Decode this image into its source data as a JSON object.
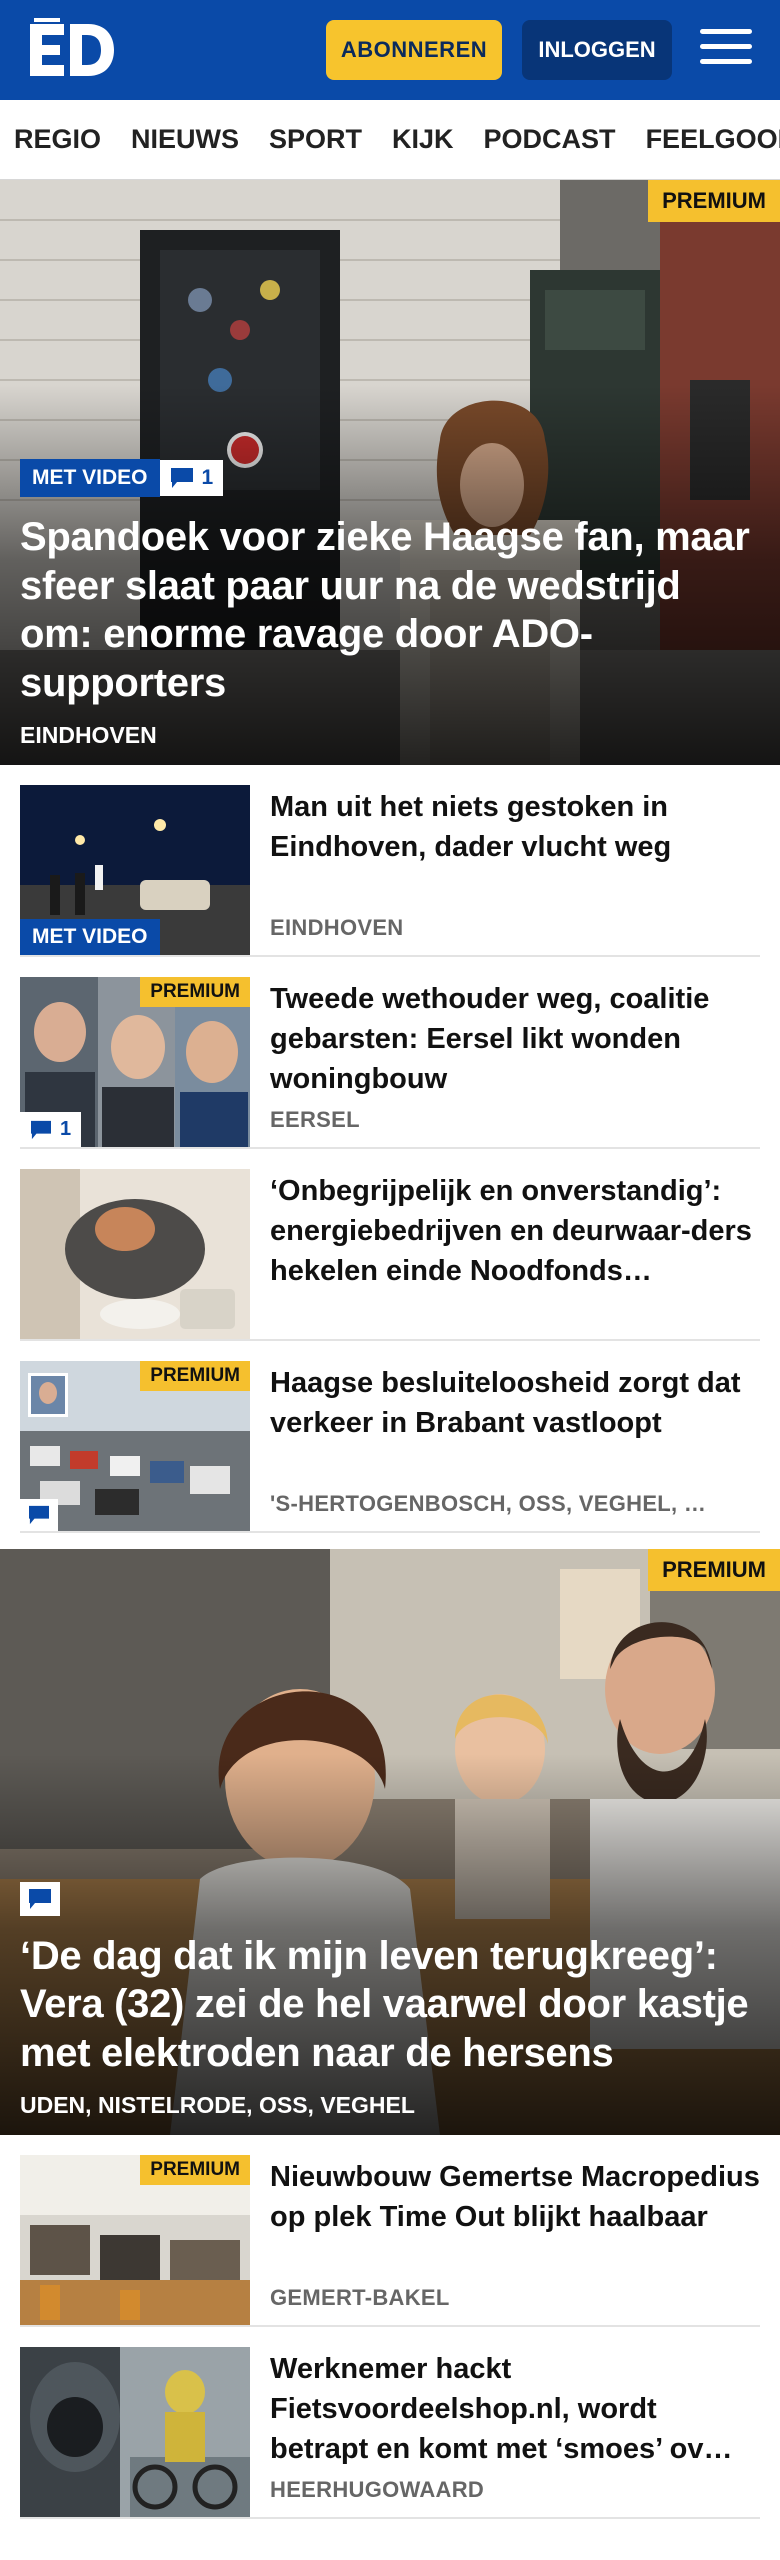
{
  "header": {
    "logo_text": "ED",
    "subscribe_label": "ABONNEREN",
    "login_label": "INLOGGEN",
    "menu_icon": "hamburger-icon"
  },
  "nav": {
    "items": [
      "REGIO",
      "NIEUWS",
      "SPORT",
      "KIJK",
      "PODCAST",
      "FEELGOOD"
    ]
  },
  "hero1": {
    "premium": "PREMIUM",
    "video_label": "MET VIDEO",
    "comment_count": "1",
    "title": "Spandoek voor zieke Haagse fan, maar sfeer slaat paar uur na de wedstrijd om: enorme ravage door ADO-supporters",
    "location": "EINDHOVEN"
  },
  "articles1": [
    {
      "title": "Man uit het niets gestoken in Eindhoven, dader vlucht weg",
      "location": "EINDHOVEN",
      "video_label": "MET VIDEO"
    },
    {
      "title": "Tweede wethouder weg, coalitie gebarsten: Eersel likt wonden woningbouw",
      "location": "EERSEL",
      "premium": "PREMIUM",
      "comment_count": "1"
    },
    {
      "title": "‘Onbegrijpelijk en onverstandig’: energiebedrijven en deurwaar-ders hekelen einde Noodfonds…",
      "location": ""
    },
    {
      "title": "Haagse besluiteloosheid zorgt dat verkeer in Brabant vastloopt",
      "location": "'S-HERTOGENBOSCH, OSS, VEGHEL, …",
      "premium": "PREMIUM"
    }
  ],
  "hero2": {
    "premium": "PREMIUM",
    "title": "‘De dag dat ik mijn leven terugkreeg’: Vera (32) zei de hel vaarwel door kastje met elektroden naar de hersens",
    "location": "UDEN, NISTELRODE, OSS, VEGHEL"
  },
  "articles2": [
    {
      "title": "Nieuwbouw Gemertse Macropedius op plek Time Out blijkt haalbaar",
      "location": "GEMERT-BAKEL",
      "premium": "PREMIUM"
    },
    {
      "title": "Werknemer hackt Fietsvoordeelshop.nl, wordt betrapt en komt met ‘smoes’ ov…",
      "location": "HEERHUGOWAARD"
    }
  ],
  "colors": {
    "brand_blue": "#0a4aa8",
    "premium_yellow": "#f5c02e",
    "subscribe_yellow": "#f7c42d"
  }
}
